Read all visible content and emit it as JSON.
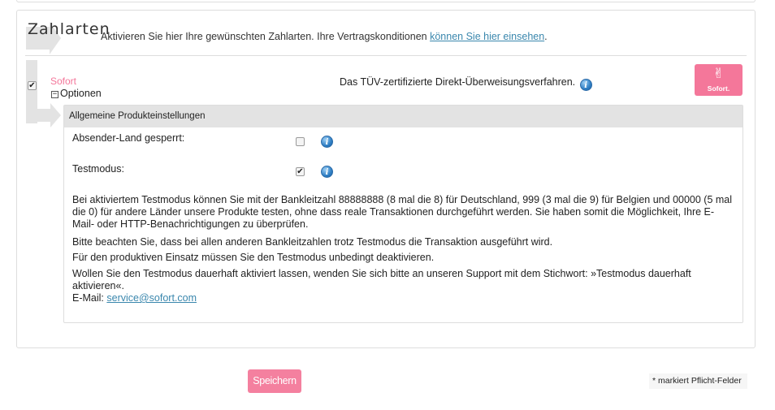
{
  "header": {
    "title": "Zahlarten",
    "subtitle_text": "Aktivieren Sie hier Ihre gewünschten Zahlarten. Ihre Vertragskonditionen ",
    "subtitle_link": "können Sie hier einsehen",
    "subtitle_end": "."
  },
  "method": {
    "enabled_check": "✔",
    "name": "Sofort",
    "options_toggle": "−",
    "options_label": "Optionen",
    "description": "Das TÜV-zertifizierte Direkt-Überweisungsverfahren.",
    "info_glyph": "i",
    "logo_symbol": "✌",
    "logo_text": "Sofort."
  },
  "settings": {
    "heading": "Allgemeine Produkteinstellungen",
    "fields": [
      {
        "label": "Absender-Land gesperrt:",
        "checked": false,
        "check_glyph": ""
      },
      {
        "label": "Testmodus:",
        "checked": true,
        "check_glyph": "✔"
      }
    ],
    "info_text": "Bei aktiviertem Testmodus können Sie mit der Bankleitzahl 88888888 (8 mal die 8) für Deutschland, 999 (3 mal die 9) für Belgien und 00000 (5 mal die 0) für andere Länder unsere Produkte testen, ohne dass reale Transaktionen durchgeführt werden. Sie haben somit die Möglichkeit, Ihre E-Mail- oder HTTP-Benachrichtigungen zu überprüfen.",
    "warning_1": "Bitte beachten Sie, dass bei allen anderen Bankleitzahlen trotz Testmodus die Transaktion ausgeführt wird.",
    "warning_2": "Für den produktiven Einsatz müssen Sie den Testmodus unbedingt deaktivieren.",
    "support_text": "Wollen Sie den Testmodus dauerhaft aktiviert lassen, wenden Sie sich bitte an unseren Support mit dem Stichwort: »Testmodus dauerhaft aktivieren«.",
    "email_label": "E-Mail: ",
    "email": "service@sofort.com"
  },
  "footer": {
    "save_label": "Speichern",
    "required_note": "* markiert Pflicht-Felder"
  },
  "colors": {
    "accent_pink": "#f4809f",
    "link_blue": "#3a87ad",
    "arrow_grey": "#e3e3e3"
  },
  "icons": [
    "checkbox-icon",
    "minus-box-icon",
    "info-icon",
    "victory-hand-icon"
  ]
}
